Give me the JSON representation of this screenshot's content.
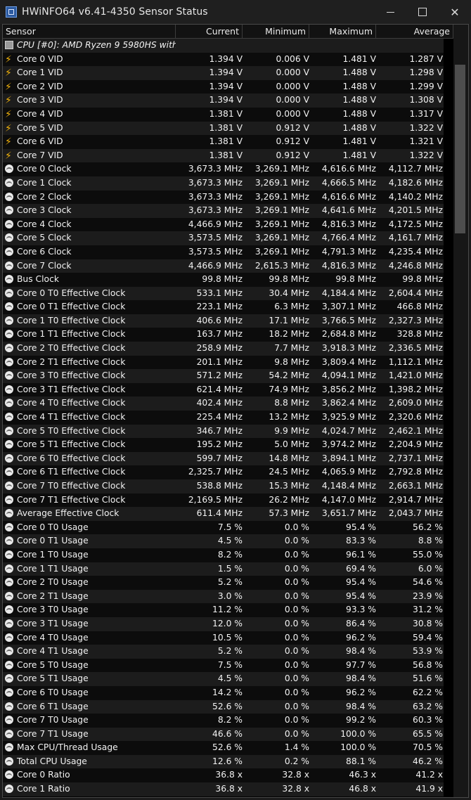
{
  "window": {
    "title": "HWiNFO64 v6.41-4350 Sensor Status",
    "minimize_icon": "minimize-icon",
    "maximize_icon": "maximize-icon",
    "close_glyph": "✕"
  },
  "columns": {
    "sensor": "Sensor",
    "current": "Current",
    "minimum": "Minimum",
    "maximum": "Maximum",
    "average": "Average"
  },
  "rows": [
    {
      "icon": "chip",
      "name": "CPU [#0]: AMD Ryzen 9 5980HS with ...",
      "cur": "",
      "min": "",
      "max": "",
      "avg": "",
      "group": true
    },
    {
      "icon": "bolt",
      "name": "Core 0 VID",
      "cur": "1.394 V",
      "min": "0.006 V",
      "max": "1.481 V",
      "avg": "1.287 V"
    },
    {
      "icon": "bolt",
      "name": "Core 1 VID",
      "cur": "1.394 V",
      "min": "0.000 V",
      "max": "1.488 V",
      "avg": "1.298 V"
    },
    {
      "icon": "bolt",
      "name": "Core 2 VID",
      "cur": "1.394 V",
      "min": "0.000 V",
      "max": "1.488 V",
      "avg": "1.299 V"
    },
    {
      "icon": "bolt",
      "name": "Core 3 VID",
      "cur": "1.394 V",
      "min": "0.000 V",
      "max": "1.488 V",
      "avg": "1.308 V"
    },
    {
      "icon": "bolt",
      "name": "Core 4 VID",
      "cur": "1.381 V",
      "min": "0.000 V",
      "max": "1.488 V",
      "avg": "1.317 V"
    },
    {
      "icon": "bolt",
      "name": "Core 5 VID",
      "cur": "1.381 V",
      "min": "0.912 V",
      "max": "1.488 V",
      "avg": "1.322 V"
    },
    {
      "icon": "bolt",
      "name": "Core 6 VID",
      "cur": "1.381 V",
      "min": "0.912 V",
      "max": "1.481 V",
      "avg": "1.321 V"
    },
    {
      "icon": "bolt",
      "name": "Core 7 VID",
      "cur": "1.381 V",
      "min": "0.912 V",
      "max": "1.481 V",
      "avg": "1.322 V"
    },
    {
      "icon": "gauge",
      "name": "Core 0 Clock",
      "cur": "3,673.3 MHz",
      "min": "3,269.1 MHz",
      "max": "4,616.6 MHz",
      "avg": "4,112.7 MHz"
    },
    {
      "icon": "gauge",
      "name": "Core 1 Clock",
      "cur": "3,673.3 MHz",
      "min": "3,269.1 MHz",
      "max": "4,666.5 MHz",
      "avg": "4,182.6 MHz"
    },
    {
      "icon": "gauge",
      "name": "Core 2 Clock",
      "cur": "3,673.3 MHz",
      "min": "3,269.1 MHz",
      "max": "4,616.6 MHz",
      "avg": "4,140.2 MHz"
    },
    {
      "icon": "gauge",
      "name": "Core 3 Clock",
      "cur": "3,673.3 MHz",
      "min": "3,269.1 MHz",
      "max": "4,641.6 MHz",
      "avg": "4,201.5 MHz"
    },
    {
      "icon": "gauge",
      "name": "Core 4 Clock",
      "cur": "4,466.9 MHz",
      "min": "3,269.1 MHz",
      "max": "4,816.3 MHz",
      "avg": "4,172.5 MHz"
    },
    {
      "icon": "gauge",
      "name": "Core 5 Clock",
      "cur": "3,573.5 MHz",
      "min": "3,269.1 MHz",
      "max": "4,766.4 MHz",
      "avg": "4,161.7 MHz"
    },
    {
      "icon": "gauge",
      "name": "Core 6 Clock",
      "cur": "3,573.5 MHz",
      "min": "3,269.1 MHz",
      "max": "4,791.3 MHz",
      "avg": "4,235.4 MHz"
    },
    {
      "icon": "gauge",
      "name": "Core 7 Clock",
      "cur": "4,466.9 MHz",
      "min": "2,615.3 MHz",
      "max": "4,816.3 MHz",
      "avg": "4,246.8 MHz"
    },
    {
      "icon": "gauge",
      "name": "Bus Clock",
      "cur": "99.8 MHz",
      "min": "99.8 MHz",
      "max": "99.8 MHz",
      "avg": "99.8 MHz"
    },
    {
      "icon": "gauge",
      "name": "Core 0 T0 Effective Clock",
      "cur": "533.1 MHz",
      "min": "30.4 MHz",
      "max": "4,184.4 MHz",
      "avg": "2,604.4 MHz"
    },
    {
      "icon": "gauge",
      "name": "Core 0 T1 Effective Clock",
      "cur": "223.1 MHz",
      "min": "6.3 MHz",
      "max": "3,307.1 MHz",
      "avg": "466.8 MHz"
    },
    {
      "icon": "gauge",
      "name": "Core 1 T0 Effective Clock",
      "cur": "406.6 MHz",
      "min": "17.1 MHz",
      "max": "3,766.5 MHz",
      "avg": "2,327.3 MHz"
    },
    {
      "icon": "gauge",
      "name": "Core 1 T1 Effective Clock",
      "cur": "163.7 MHz",
      "min": "18.2 MHz",
      "max": "2,684.8 MHz",
      "avg": "328.8 MHz"
    },
    {
      "icon": "gauge",
      "name": "Core 2 T0 Effective Clock",
      "cur": "258.9 MHz",
      "min": "7.7 MHz",
      "max": "3,918.3 MHz",
      "avg": "2,336.5 MHz"
    },
    {
      "icon": "gauge",
      "name": "Core 2 T1 Effective Clock",
      "cur": "201.1 MHz",
      "min": "9.8 MHz",
      "max": "3,809.4 MHz",
      "avg": "1,112.1 MHz"
    },
    {
      "icon": "gauge",
      "name": "Core 3 T0 Effective Clock",
      "cur": "571.2 MHz",
      "min": "54.2 MHz",
      "max": "4,094.1 MHz",
      "avg": "1,421.0 MHz"
    },
    {
      "icon": "gauge",
      "name": "Core 3 T1 Effective Clock",
      "cur": "621.4 MHz",
      "min": "74.9 MHz",
      "max": "3,856.2 MHz",
      "avg": "1,398.2 MHz"
    },
    {
      "icon": "gauge",
      "name": "Core 4 T0 Effective Clock",
      "cur": "402.4 MHz",
      "min": "8.8 MHz",
      "max": "3,862.4 MHz",
      "avg": "2,609.0 MHz"
    },
    {
      "icon": "gauge",
      "name": "Core 4 T1 Effective Clock",
      "cur": "225.4 MHz",
      "min": "13.2 MHz",
      "max": "3,925.9 MHz",
      "avg": "2,320.6 MHz"
    },
    {
      "icon": "gauge",
      "name": "Core 5 T0 Effective Clock",
      "cur": "346.7 MHz",
      "min": "9.9 MHz",
      "max": "4,024.7 MHz",
      "avg": "2,462.1 MHz"
    },
    {
      "icon": "gauge",
      "name": "Core 5 T1 Effective Clock",
      "cur": "195.2 MHz",
      "min": "5.0 MHz",
      "max": "3,974.2 MHz",
      "avg": "2,204.9 MHz"
    },
    {
      "icon": "gauge",
      "name": "Core 6 T0 Effective Clock",
      "cur": "599.7 MHz",
      "min": "14.8 MHz",
      "max": "3,894.1 MHz",
      "avg": "2,737.1 MHz"
    },
    {
      "icon": "gauge",
      "name": "Core 6 T1 Effective Clock",
      "cur": "2,325.7 MHz",
      "min": "24.5 MHz",
      "max": "4,065.9 MHz",
      "avg": "2,792.8 MHz"
    },
    {
      "icon": "gauge",
      "name": "Core 7 T0 Effective Clock",
      "cur": "538.8 MHz",
      "min": "15.3 MHz",
      "max": "4,148.4 MHz",
      "avg": "2,663.1 MHz"
    },
    {
      "icon": "gauge",
      "name": "Core 7 T1 Effective Clock",
      "cur": "2,169.5 MHz",
      "min": "26.2 MHz",
      "max": "4,147.0 MHz",
      "avg": "2,914.7 MHz"
    },
    {
      "icon": "gauge",
      "name": "Average Effective Clock",
      "cur": "611.4 MHz",
      "min": "57.3 MHz",
      "max": "3,651.7 MHz",
      "avg": "2,043.7 MHz"
    },
    {
      "icon": "gauge",
      "name": "Core 0 T0 Usage",
      "cur": "7.5 %",
      "min": "0.0 %",
      "max": "95.4 %",
      "avg": "56.2 %"
    },
    {
      "icon": "gauge",
      "name": "Core 0 T1 Usage",
      "cur": "4.5 %",
      "min": "0.0 %",
      "max": "83.3 %",
      "avg": "8.8 %"
    },
    {
      "icon": "gauge",
      "name": "Core 1 T0 Usage",
      "cur": "8.2 %",
      "min": "0.0 %",
      "max": "96.1 %",
      "avg": "55.0 %"
    },
    {
      "icon": "gauge",
      "name": "Core 1 T1 Usage",
      "cur": "1.5 %",
      "min": "0.0 %",
      "max": "69.4 %",
      "avg": "6.0 %"
    },
    {
      "icon": "gauge",
      "name": "Core 2 T0 Usage",
      "cur": "5.2 %",
      "min": "0.0 %",
      "max": "95.4 %",
      "avg": "54.6 %"
    },
    {
      "icon": "gauge",
      "name": "Core 2 T1 Usage",
      "cur": "3.0 %",
      "min": "0.0 %",
      "max": "95.4 %",
      "avg": "23.9 %"
    },
    {
      "icon": "gauge",
      "name": "Core 3 T0 Usage",
      "cur": "11.2 %",
      "min": "0.0 %",
      "max": "93.3 %",
      "avg": "31.2 %"
    },
    {
      "icon": "gauge",
      "name": "Core 3 T1 Usage",
      "cur": "12.0 %",
      "min": "0.0 %",
      "max": "86.4 %",
      "avg": "30.8 %"
    },
    {
      "icon": "gauge",
      "name": "Core 4 T0 Usage",
      "cur": "10.5 %",
      "min": "0.0 %",
      "max": "96.2 %",
      "avg": "59.4 %"
    },
    {
      "icon": "gauge",
      "name": "Core 4 T1 Usage",
      "cur": "5.2 %",
      "min": "0.0 %",
      "max": "98.4 %",
      "avg": "53.9 %"
    },
    {
      "icon": "gauge",
      "name": "Core 5 T0 Usage",
      "cur": "7.5 %",
      "min": "0.0 %",
      "max": "97.7 %",
      "avg": "56.8 %"
    },
    {
      "icon": "gauge",
      "name": "Core 5 T1 Usage",
      "cur": "4.5 %",
      "min": "0.0 %",
      "max": "98.4 %",
      "avg": "51.6 %"
    },
    {
      "icon": "gauge",
      "name": "Core 6 T0 Usage",
      "cur": "14.2 %",
      "min": "0.0 %",
      "max": "96.2 %",
      "avg": "62.2 %"
    },
    {
      "icon": "gauge",
      "name": "Core 6 T1 Usage",
      "cur": "52.6 %",
      "min": "0.0 %",
      "max": "98.4 %",
      "avg": "63.2 %"
    },
    {
      "icon": "gauge",
      "name": "Core 7 T0 Usage",
      "cur": "8.2 %",
      "min": "0.0 %",
      "max": "99.2 %",
      "avg": "60.3 %"
    },
    {
      "icon": "gauge",
      "name": "Core 7 T1 Usage",
      "cur": "46.6 %",
      "min": "0.0 %",
      "max": "100.0 %",
      "avg": "65.5 %"
    },
    {
      "icon": "gauge",
      "name": "Max CPU/Thread Usage",
      "cur": "52.6 %",
      "min": "1.4 %",
      "max": "100.0 %",
      "avg": "70.5 %"
    },
    {
      "icon": "gauge",
      "name": "Total CPU Usage",
      "cur": "12.6 %",
      "min": "0.2 %",
      "max": "88.1 %",
      "avg": "46.2 %"
    },
    {
      "icon": "gauge",
      "name": "Core 0 Ratio",
      "cur": "36.8 x",
      "min": "32.8 x",
      "max": "46.3 x",
      "avg": "41.2 x"
    },
    {
      "icon": "gauge",
      "name": "Core 1 Ratio",
      "cur": "36.8 x",
      "min": "32.8 x",
      "max": "46.8 x",
      "avg": "41.9 x"
    }
  ]
}
